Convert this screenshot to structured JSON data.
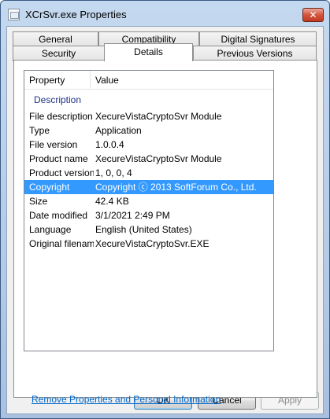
{
  "window": {
    "title": "XCrSvr.exe Properties",
    "close_glyph": "✕"
  },
  "tabs": {
    "row1": [
      "General",
      "Compatibility",
      "Digital Signatures"
    ],
    "row2": [
      "Security",
      "Details",
      "Previous Versions"
    ],
    "active": "Details"
  },
  "details": {
    "columns": [
      "Property",
      "Value"
    ],
    "group_label": "Description",
    "rows": [
      {
        "property": "File description",
        "value": "XecureVistaCryptoSvr Module"
      },
      {
        "property": "Type",
        "value": "Application"
      },
      {
        "property": "File version",
        "value": "1.0.0.4"
      },
      {
        "property": "Product name",
        "value": "XecureVistaCryptoSvr Module"
      },
      {
        "property": "Product version",
        "value": "1, 0, 0, 4"
      },
      {
        "property": "Copyright",
        "value": "Copyright ⓒ 2013 SoftForum Co., Ltd."
      },
      {
        "property": "Size",
        "value": "42.4 KB"
      },
      {
        "property": "Date modified",
        "value": "3/1/2021 2:49 PM"
      },
      {
        "property": "Language",
        "value": "English (United States)"
      },
      {
        "property": "Original filename",
        "value": "XecureVistaCryptoSvr.EXE"
      }
    ],
    "selected_property": "Copyright"
  },
  "link": {
    "remove_properties": "Remove Properties and Personal Information"
  },
  "buttons": {
    "ok": "OK",
    "cancel": "Cancel",
    "apply": "Apply"
  },
  "colors": {
    "selection": "#3399ff",
    "group_text": "#1e3287",
    "link": "#0066cc"
  }
}
